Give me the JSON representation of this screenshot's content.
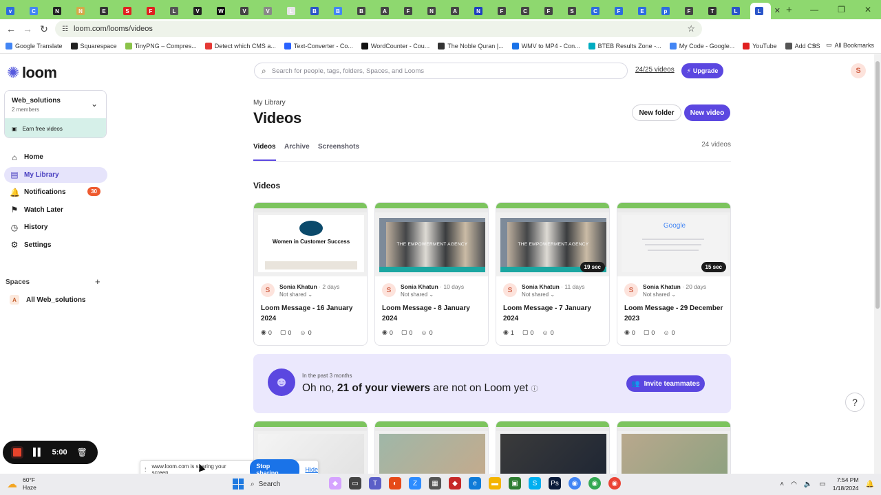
{
  "browser": {
    "tabs": [
      {
        "icon_color": "#2d6cdf",
        "label": "v"
      },
      {
        "icon_color": "#4285f4",
        "label": "C"
      },
      {
        "icon_color": "#222222",
        "label": "N"
      },
      {
        "icon_color": "#d4a94a",
        "label": "N"
      },
      {
        "icon_color": "#333333",
        "label": "E"
      },
      {
        "icon_color": "#e02020",
        "label": "S"
      },
      {
        "icon_color": "#e02020",
        "label": "F"
      },
      {
        "icon_color": "#555555",
        "label": "L"
      },
      {
        "icon_color": "#222222",
        "label": "V"
      },
      {
        "icon_color": "#111111",
        "label": "W"
      },
      {
        "icon_color": "#444444",
        "label": "V"
      },
      {
        "icon_color": "#888888",
        "label": "V"
      },
      {
        "icon_color": "#e6e6e6",
        "label": "L"
      },
      {
        "icon_color": "#2a55c9",
        "label": "B"
      },
      {
        "icon_color": "#4285f4",
        "label": "B"
      },
      {
        "icon_color": "#444444",
        "label": "B"
      },
      {
        "icon_color": "#444444",
        "label": "A"
      },
      {
        "icon_color": "#444444",
        "label": "F"
      },
      {
        "icon_color": "#444444",
        "label": "N"
      },
      {
        "icon_color": "#444444",
        "label": "A"
      },
      {
        "icon_color": "#1e3fbf",
        "label": "N"
      },
      {
        "icon_color": "#444444",
        "label": "F"
      },
      {
        "icon_color": "#444444",
        "label": "C"
      },
      {
        "icon_color": "#444444",
        "label": "F"
      },
      {
        "icon_color": "#444444",
        "label": "S"
      },
      {
        "icon_color": "#2d6cdf",
        "label": "C"
      },
      {
        "icon_color": "#2d6cdf",
        "label": "F"
      },
      {
        "icon_color": "#2d6cdf",
        "label": "E"
      },
      {
        "icon_color": "#2d6cdf",
        "label": "p"
      },
      {
        "icon_color": "#444444",
        "label": "F"
      },
      {
        "icon_color": "#333333",
        "label": "T"
      },
      {
        "icon_color": "#2a55c9",
        "label": "L"
      }
    ],
    "active_tab_label": "L",
    "url": "loom.com/looms/videos",
    "bookmarks": [
      {
        "label": "Google Translate",
        "color": "#4285f4"
      },
      {
        "label": "Squarespace",
        "color": "#222222"
      },
      {
        "label": "TinyPNG – Compres...",
        "color": "#8bc34a"
      },
      {
        "label": "Detect which CMS a...",
        "color": "#e53935"
      },
      {
        "label": "Text-Converter - Co...",
        "color": "#2962ff"
      },
      {
        "label": "WordCounter - Cou...",
        "color": "#111111"
      },
      {
        "label": "The Noble Quran |...",
        "color": "#333333"
      },
      {
        "label": "WMV to MP4 - Con...",
        "color": "#1a73e8"
      },
      {
        "label": "BTEB Results Zone -...",
        "color": "#00acc1"
      },
      {
        "label": "My Code - Google...",
        "color": "#4285f4"
      },
      {
        "label": "YouTube",
        "color": "#e02020"
      },
      {
        "label": "Add CSS",
        "color": "#555555"
      }
    ],
    "all_bookmarks": "All Bookmarks"
  },
  "sidebar": {
    "brand": "loom",
    "workspace": {
      "name": "Web_solutions",
      "members": "2 members",
      "earn": "Earn free videos"
    },
    "nav": [
      {
        "label": "Home",
        "icon": "home-icon",
        "glyph": "⌂",
        "active": false
      },
      {
        "label": "My Library",
        "icon": "library-icon",
        "glyph": "▤",
        "active": true
      },
      {
        "label": "Notifications",
        "icon": "bell-icon",
        "glyph": "🔔",
        "active": false,
        "badge": "30"
      },
      {
        "label": "Watch Later",
        "icon": "bookmark-icon",
        "glyph": "⚑",
        "active": false
      },
      {
        "label": "History",
        "icon": "clock-icon",
        "glyph": "◷",
        "active": false
      },
      {
        "label": "Settings",
        "icon": "gear-icon",
        "glyph": "⚙",
        "active": false
      }
    ],
    "spaces_label": "Spaces",
    "space_item": {
      "avatar": "A",
      "label": "All Web_solutions"
    }
  },
  "recorder": {
    "time": "5:00"
  },
  "header": {
    "search_placeholder": "Search for people, tags, folders, Spaces, and Looms",
    "quota": "24/25 videos",
    "upgrade": "Upgrade",
    "user_initial": "S"
  },
  "library": {
    "breadcrumb": "My Library",
    "title": "Videos",
    "new_folder": "New folder",
    "new_video": "New video",
    "tabs": [
      "Videos",
      "Archive",
      "Screenshots"
    ],
    "count": "24 videos",
    "section_title": "Videos"
  },
  "videos": [
    {
      "author": "Sonia Khatun",
      "age": "2 days",
      "share": "Not shared",
      "title": "Loom Message - 16 January 2024",
      "views": "0",
      "comments": "0",
      "reactions": "0",
      "duration": "",
      "thumb_text": "Women in Customer Success",
      "thumb_style": "logo"
    },
    {
      "author": "Sonia Khatun",
      "age": "10 days",
      "share": "Not shared",
      "title": "Loom Message - 8 January 2024",
      "views": "0",
      "comments": "0",
      "reactions": "0",
      "duration": "",
      "thumb_text": "THE EMPOWERMENT AGENCY",
      "thumb_style": "photo"
    },
    {
      "author": "Sonia Khatun",
      "age": "11 days",
      "share": "Not shared",
      "title": "Loom Message - 7 January 2024",
      "views": "1",
      "comments": "0",
      "reactions": "0",
      "duration": "19 sec",
      "thumb_text": "THE EMPOWERMENT AGENCY",
      "thumb_style": "photo"
    },
    {
      "author": "Sonia Khatun",
      "age": "20 days",
      "share": "Not shared",
      "title": "Loom Message - 29 December 2023",
      "views": "0",
      "comments": "0",
      "reactions": "0",
      "duration": "15 sec",
      "thumb_text": "Google",
      "thumb_style": "google"
    }
  ],
  "promo": {
    "small": "In the past 3 months",
    "lead": "Oh no, ",
    "bold": "21 of your viewers",
    "rest": " are not on Loom yet",
    "cta": "Invite teammates"
  },
  "sharebar": {
    "text": "www.loom.com is sharing your screen.",
    "stop": "Stop sharing",
    "hide": "Hide"
  },
  "taskbar": {
    "temp": "60°F",
    "condition": "Haze",
    "search": "Search",
    "time": "7:54 PM",
    "date": "1/18/2024"
  }
}
